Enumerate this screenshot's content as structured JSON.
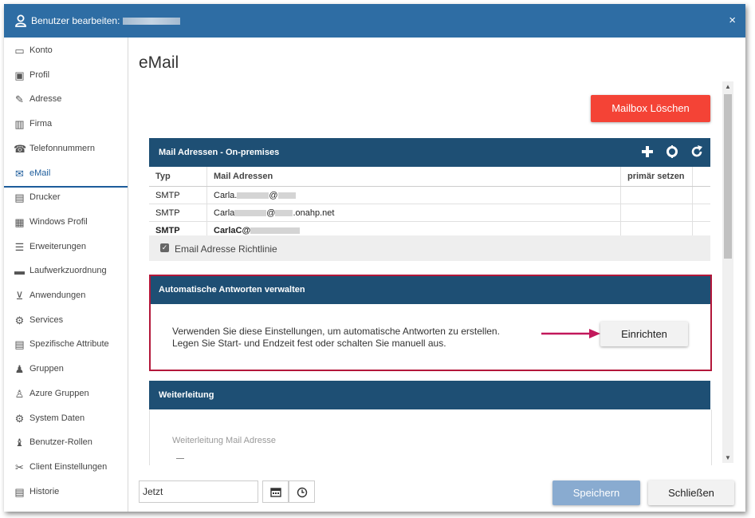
{
  "window": {
    "title_prefix": "Benutzer bearbeiten:",
    "close_symbol": "×"
  },
  "sidebar": {
    "items": [
      {
        "label": "Konto",
        "icon": "card-icon"
      },
      {
        "label": "Profil",
        "icon": "profile-icon"
      },
      {
        "label": "Adresse",
        "icon": "edit-icon"
      },
      {
        "label": "Firma",
        "icon": "building-icon"
      },
      {
        "label": "Telefonnummern",
        "icon": "phone-icon"
      },
      {
        "label": "eMail",
        "icon": "mail-icon"
      },
      {
        "label": "Drucker",
        "icon": "printer-icon"
      },
      {
        "label": "Windows Profil",
        "icon": "save-icon"
      },
      {
        "label": "Erweiterungen",
        "icon": "list-icon"
      },
      {
        "label": "Laufwerkzuordnung",
        "icon": "drive-icon"
      },
      {
        "label": "Anwendungen",
        "icon": "cart-icon"
      },
      {
        "label": "Services",
        "icon": "gear-icon"
      },
      {
        "label": "Spezifische Attribute",
        "icon": "document-icon"
      },
      {
        "label": "Gruppen",
        "icon": "users-icon"
      },
      {
        "label": "Azure Gruppen",
        "icon": "user-outline-icon"
      },
      {
        "label": "System Daten",
        "icon": "cogs-icon"
      },
      {
        "label": "Benutzer-Rollen",
        "icon": "user-role-icon"
      },
      {
        "label": "Client Einstellungen",
        "icon": "wrench-icon"
      },
      {
        "label": "Historie",
        "icon": "history-icon"
      }
    ],
    "active_index": 5
  },
  "main": {
    "title": "eMail",
    "delete_button": "Mailbox Löschen",
    "mail_panel": {
      "title": "Mail Adressen - On-premises",
      "columns": [
        "Typ",
        "Mail Adressen",
        "primär setzen",
        ""
      ],
      "rows": [
        {
          "type": "SMTP",
          "address_start": "Carla.",
          "address_mid": "@",
          "address_end": "",
          "bold": false
        },
        {
          "type": "SMTP",
          "address_start": "Carla",
          "address_mid": "@",
          "address_end": ".onahp.net",
          "bold": false
        },
        {
          "type": "SMTP",
          "address_start": "CarlaC@",
          "address_mid": "",
          "address_end": "",
          "bold": true
        }
      ],
      "policy_label": "Email Adresse Richtlinie",
      "policy_checked": true
    },
    "auto_reply": {
      "title": "Automatische Antworten verwalten",
      "line1": "Verwenden Sie diese Einstellungen, um automatische Antworten zu erstellen.",
      "line2": "Legen Sie Start- und Endzeit fest oder schalten Sie manuell aus.",
      "button": "Einrichten"
    },
    "forwarding": {
      "title": "Weiterleitung",
      "field_label": "Weiterleitung Mail Adresse"
    }
  },
  "footer": {
    "date_value": "Jetzt",
    "save_button": "Speichern",
    "close_button": "Schließen"
  },
  "colors": {
    "titlebar": "#2e6da4",
    "panel_header": "#1e4f74",
    "delete": "#f44336",
    "highlight_border": "#b3173a",
    "save": "#89abd0"
  }
}
